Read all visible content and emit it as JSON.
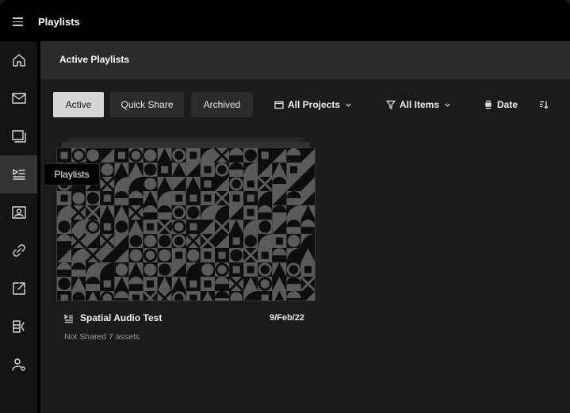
{
  "app": {
    "title": "Playlists"
  },
  "sidebar": {
    "items": [
      {
        "icon": "home-icon"
      },
      {
        "icon": "inbox-icon"
      },
      {
        "icon": "layers-icon"
      },
      {
        "icon": "playlists-icon",
        "active": true
      },
      {
        "icon": "contact-card-icon"
      },
      {
        "icon": "link-icon"
      },
      {
        "icon": "share-icon"
      },
      {
        "icon": "compare-icon"
      },
      {
        "icon": "user-settings-icon"
      }
    ],
    "tooltip": "Playlists"
  },
  "subheader": {
    "title": "Active Playlists"
  },
  "tabs": [
    {
      "label": "Active",
      "active": true
    },
    {
      "label": "Quick Share"
    },
    {
      "label": "Archived"
    }
  ],
  "filters": {
    "projects": "All Projects",
    "items": "All Items",
    "sort": "Date"
  },
  "playlist": {
    "title": "Spatial Audio Test",
    "date": "9/Feb/22",
    "share_status": "Not Shared",
    "asset_count": "7 assets"
  },
  "colors": {
    "background": "#1b1b1b",
    "topbar": "#000000",
    "active_tab": "#d6d6d6"
  }
}
